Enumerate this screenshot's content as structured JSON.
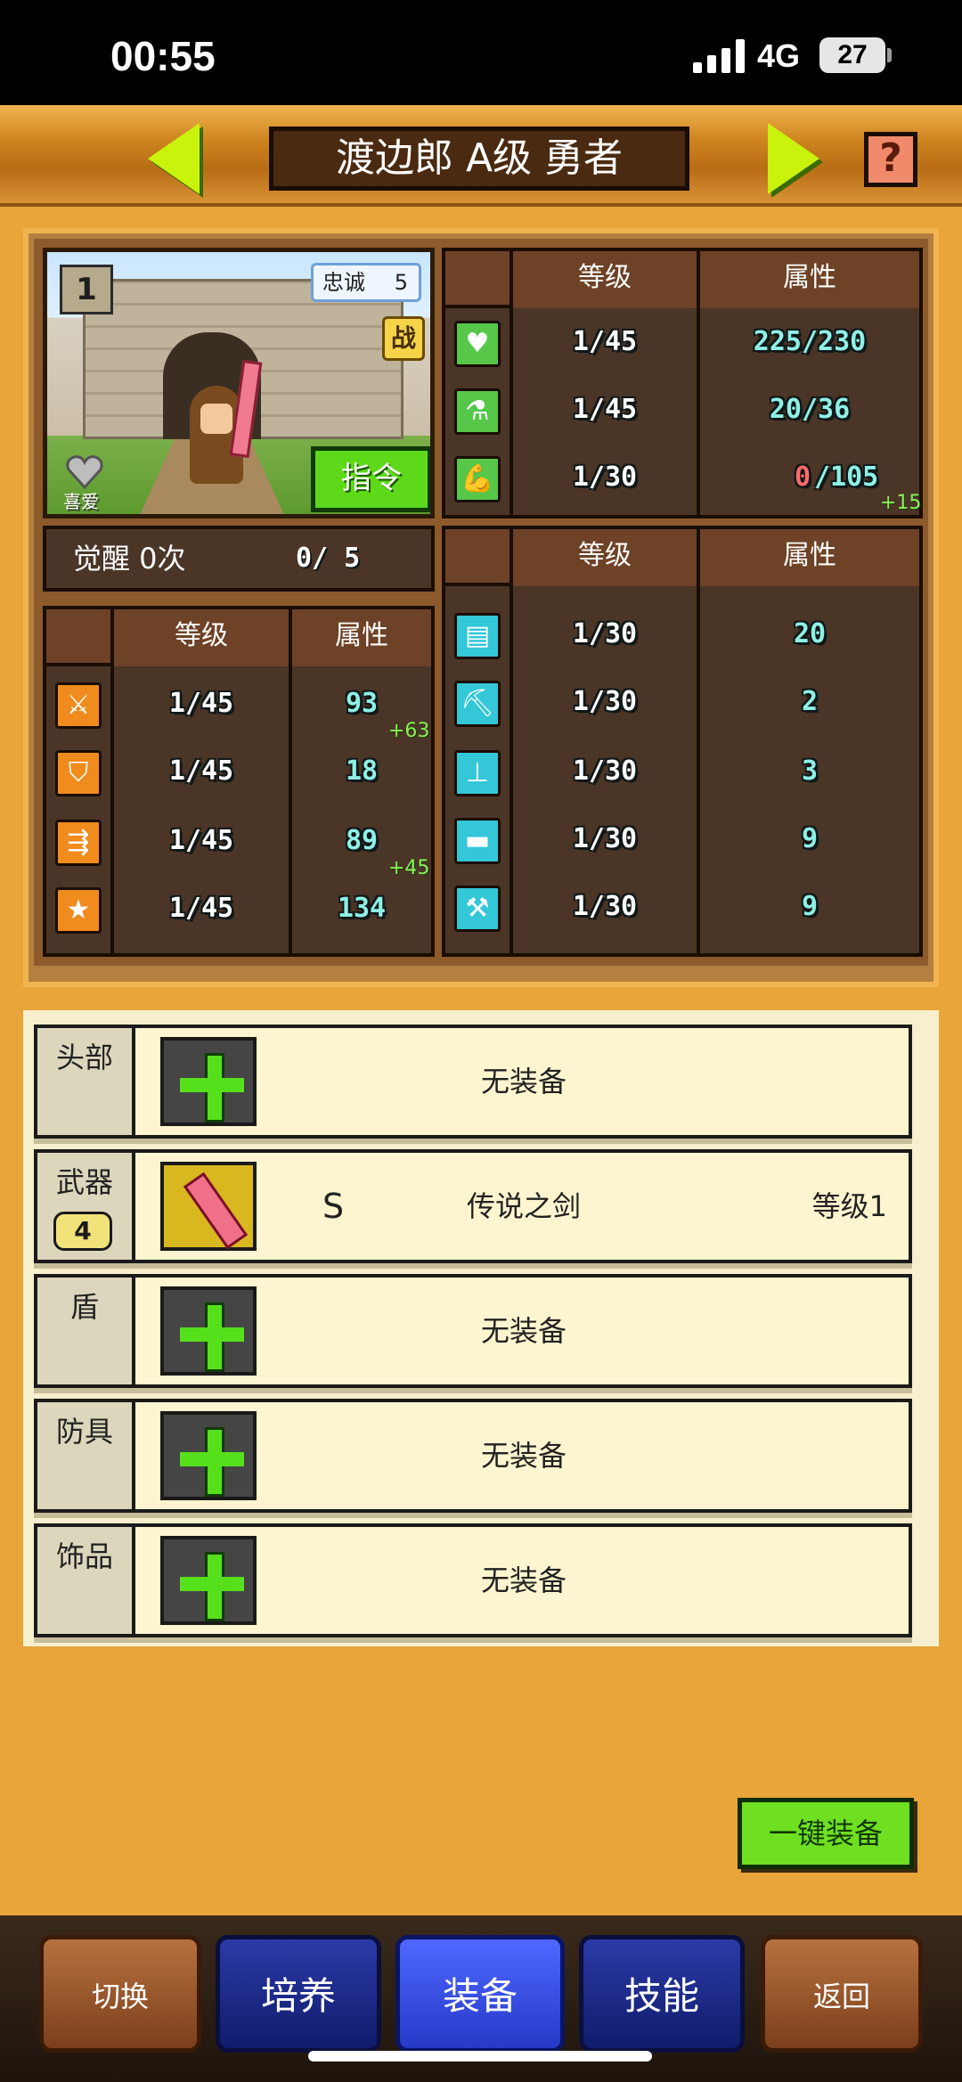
{
  "status_bar": {
    "time": "00:55",
    "network": "4G",
    "battery": "27"
  },
  "header": {
    "hero_name": "渡边郎 A级 勇者",
    "help": "?"
  },
  "portrait": {
    "level_badge": "1",
    "loyalty_label": "忠诚",
    "loyalty_value": "5",
    "battle_icon": "战",
    "favorite_label": "喜爱",
    "command_button": "指令"
  },
  "top_stats": {
    "headers": [
      "等级",
      "属性"
    ],
    "rows": [
      {
        "icon": "heart-icon",
        "level": "1/45",
        "value": "225/230",
        "bonus": ""
      },
      {
        "icon": "potion-icon",
        "level": "1/45",
        "value": "20/36",
        "bonus": ""
      },
      {
        "icon": "muscle-icon",
        "level": "1/30",
        "value_current": "0",
        "value_max": "/105",
        "bonus": "+15"
      }
    ]
  },
  "awaken": {
    "label": "觉醒 0次",
    "count": "0/ 5"
  },
  "combat_stats": {
    "headers": [
      "等级",
      "属性"
    ],
    "rows": [
      {
        "icon": "sword-icon",
        "level": "1/45",
        "value": "93",
        "bonus": "+63"
      },
      {
        "icon": "shield-icon",
        "level": "1/45",
        "value": "18",
        "bonus": ""
      },
      {
        "icon": "speed-arrows-icon",
        "level": "1/45",
        "value": "89",
        "bonus": "+45"
      },
      {
        "icon": "star-icon",
        "level": "1/45",
        "value": "134",
        "bonus": ""
      }
    ]
  },
  "skill_stats": {
    "headers": [
      "等级",
      "属性"
    ],
    "rows": [
      {
        "icon": "book-icon",
        "level": "1/30",
        "value": "20"
      },
      {
        "icon": "pickaxe-icon",
        "level": "1/30",
        "value": "2"
      },
      {
        "icon": "shovel-icon",
        "level": "1/30",
        "value": "3"
      },
      {
        "icon": "anvil-icon",
        "level": "1/30",
        "value": "9"
      },
      {
        "icon": "hammer-icon",
        "level": "1/30",
        "value": "9"
      }
    ]
  },
  "equipment": {
    "slots": [
      {
        "label": "头部",
        "empty_text": "无装备"
      },
      {
        "label": "武器",
        "badge": "4",
        "rank": "S",
        "item_name": "传说之剑",
        "item_level": "等级1"
      },
      {
        "label": "盾",
        "empty_text": "无装备"
      },
      {
        "label": "防具",
        "empty_text": "无装备"
      },
      {
        "label": "饰品",
        "empty_text": "无装备"
      }
    ],
    "auto_equip_button": "一键装备"
  },
  "bottom_nav": {
    "switch": "切换",
    "train": "培养",
    "equip": "装备",
    "skills": "技能",
    "back": "返回"
  }
}
